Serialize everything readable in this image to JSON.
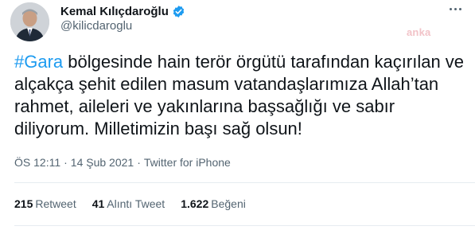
{
  "author": {
    "display_name": "Kemal Kılıçdaroğlu",
    "handle": "@kilicdaroglu",
    "verified": true
  },
  "watermark": "anka",
  "tweet": {
    "hashtag": "#Gara",
    "text": " bölgesinde hain terör örgütü tarafından kaçırılan ve alçakça şehit edilen masum vatandaşlarımıza Allah’tan rahmet, aileleri ve yakınlarına başsağlığı ve sabır diliyorum. Milletimizin başı sağ olsun!"
  },
  "meta": {
    "time": "ÖS 12:11",
    "sep1": "·",
    "date": "14 Şub 2021",
    "sep2": "·",
    "source": "Twitter for iPhone"
  },
  "stats": [
    {
      "count": "215",
      "label": "Retweet"
    },
    {
      "count": "41",
      "label": "Alıntı Tweet"
    },
    {
      "count": "1.622",
      "label": "Beğeni"
    }
  ],
  "colors": {
    "link": "#1d9bf0",
    "verified": "#1d9bf0",
    "muted": "#536471",
    "text": "#0f1419"
  },
  "icons": {
    "verified": "verified-badge-icon",
    "more": "more-options-icon"
  }
}
